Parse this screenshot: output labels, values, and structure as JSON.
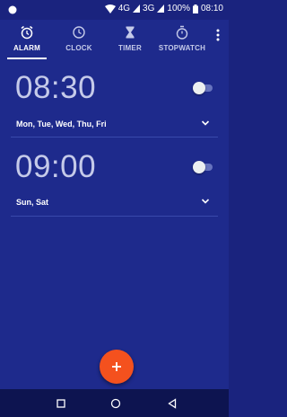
{
  "status_bar": {
    "network_4g": "4G",
    "network_3g": "3G",
    "battery": "100%",
    "time": "08:10"
  },
  "tabs": [
    {
      "label": "ALARM",
      "icon": "alarm-clock-icon",
      "active": true
    },
    {
      "label": "CLOCK",
      "icon": "clock-icon",
      "active": false
    },
    {
      "label": "TIMER",
      "icon": "hourglass-icon",
      "active": false
    },
    {
      "label": "STOPWATCH",
      "icon": "stopwatch-icon",
      "active": false
    }
  ],
  "alarms": [
    {
      "time": "08:30",
      "days": "Mon, Tue, Wed, Thu, Fri",
      "enabled": false
    },
    {
      "time": "09:00",
      "days": "Sun, Sat",
      "enabled": false
    }
  ],
  "fab": {
    "icon": "plus-icon"
  },
  "nav": {
    "buttons": [
      "recents-square-icon",
      "home-circle-icon",
      "back-triangle-icon"
    ]
  },
  "colors": {
    "background": "#1e2a8c",
    "status_bar": "#1a237e",
    "fab": "#f4511e",
    "nav_bar": "#0d1450",
    "time_text": "#c5cae9"
  }
}
